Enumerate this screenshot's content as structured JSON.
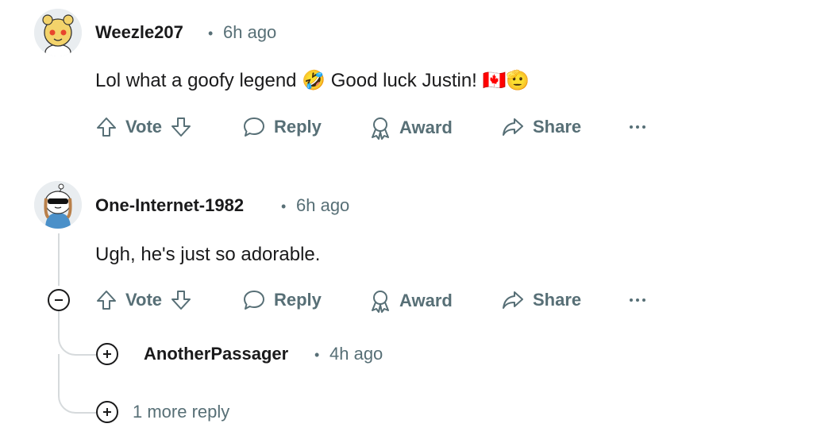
{
  "comments": [
    {
      "username": "Weezle207",
      "time": "6h ago",
      "body": "Lol what a goofy legend 🤣 Good luck Justin! 🇨🇦🫡",
      "actions": {
        "vote": "Vote",
        "reply": "Reply",
        "award": "Award",
        "share": "Share"
      }
    },
    {
      "username": "One-Internet-1982",
      "time": "6h ago",
      "body": "Ugh, he's just so adorable.",
      "actions": {
        "vote": "Vote",
        "reply": "Reply",
        "award": "Award",
        "share": "Share"
      }
    }
  ],
  "collapsed_reply": {
    "username": "AnotherPassager",
    "time": "4h ago"
  },
  "more_replies_label": "1 more reply",
  "icons": {
    "upvote": "upvote-icon",
    "downvote": "downvote-icon",
    "reply": "comment-bubble-icon",
    "award": "award-ribbon-icon",
    "share": "share-arrow-icon",
    "overflow": "ellipsis-icon",
    "collapse": "minus-circle-icon",
    "expand": "plus-circle-icon"
  },
  "colors": {
    "text_primary": "#1a1a1b",
    "text_secondary": "#576f76",
    "thread_line": "#d6dadc"
  }
}
